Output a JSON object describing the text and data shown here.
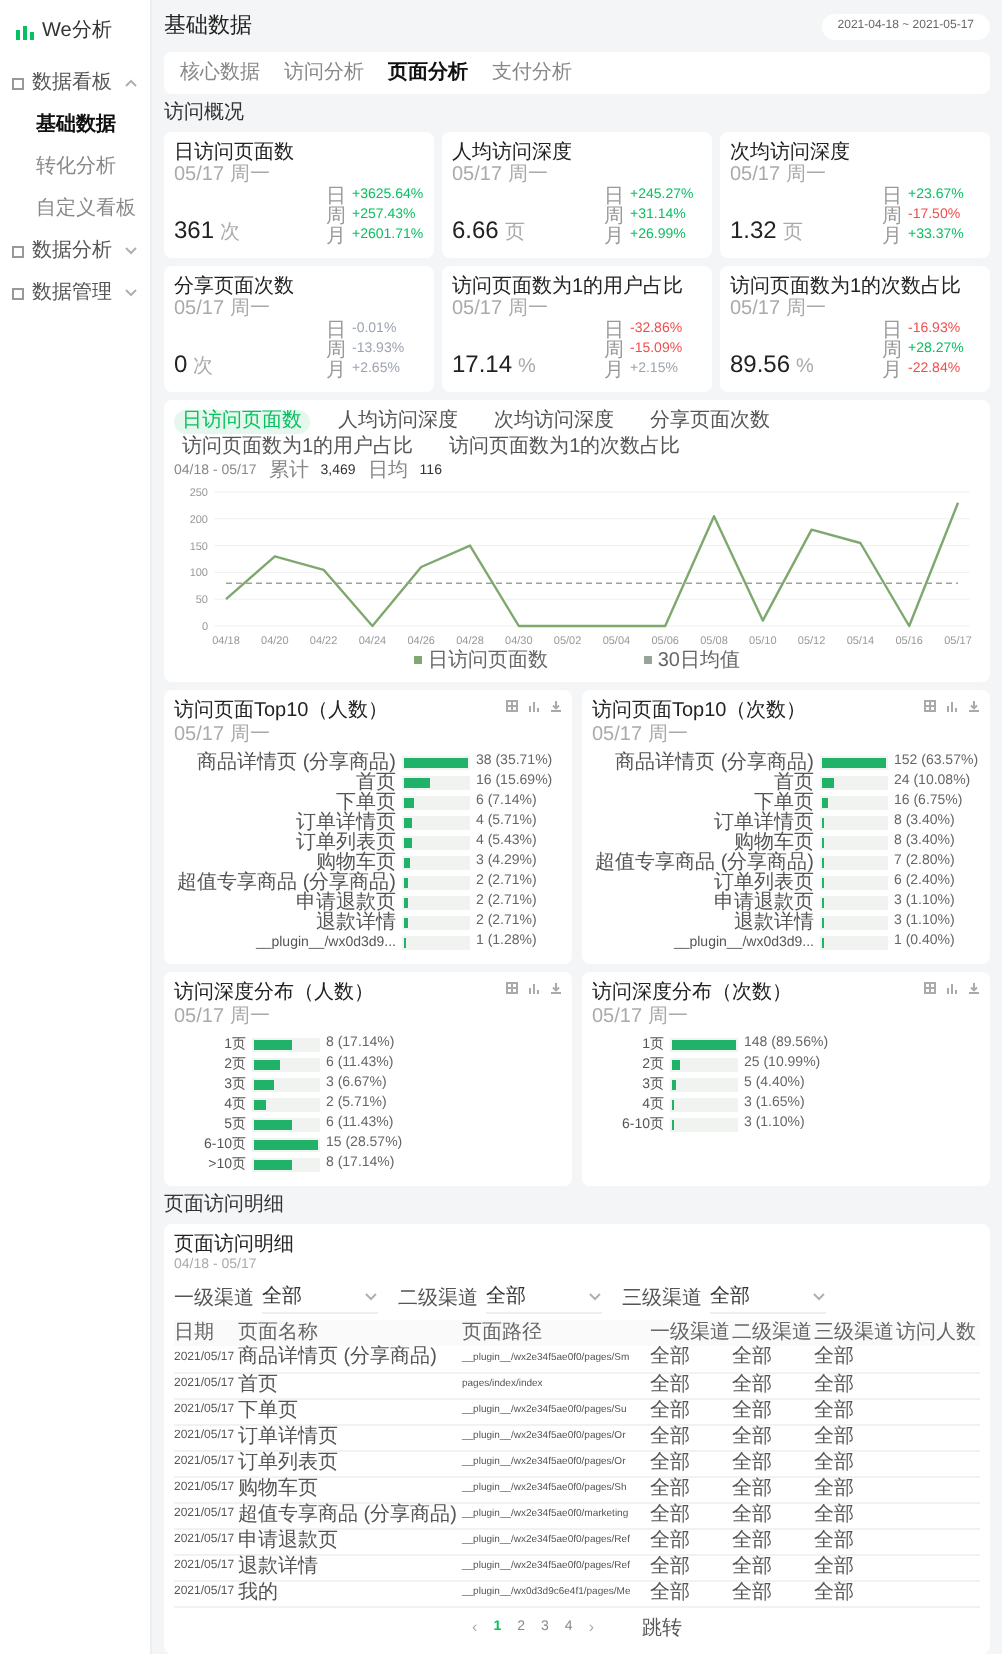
{
  "sidebar": {
    "logo": "We分析",
    "items": [
      {
        "label": "数据看板",
        "expanded": true,
        "children": [
          {
            "label": "基础数据",
            "selected": true
          },
          {
            "label": "转化分析",
            "selected": false
          },
          {
            "label": "自定义看板",
            "selected": false
          }
        ]
      },
      {
        "label": "数据分析",
        "expanded": false
      },
      {
        "label": "数据管理",
        "expanded": false
      }
    ]
  },
  "header": {
    "title": "基础数据",
    "date_range": "2021-04-18 ~ 2021-05-17"
  },
  "tabs": [
    {
      "label": "核心数据",
      "selected": false
    },
    {
      "label": "访问分析",
      "selected": false
    },
    {
      "label": "页面分析",
      "selected": true
    },
    {
      "label": "支付分析",
      "selected": false
    }
  ],
  "overview": {
    "title": "访问概况",
    "cards": [
      {
        "title": "日访问页面数",
        "date": "05/17 周一",
        "value": "361",
        "unit": "次",
        "changes": [
          {
            "label": "日",
            "value": "+3625.64%",
            "kind": "up"
          },
          {
            "label": "周",
            "value": "+257.43%",
            "kind": "up"
          },
          {
            "label": "月",
            "value": "+2601.71%",
            "kind": "up"
          }
        ]
      },
      {
        "title": "人均访问深度",
        "date": "05/17 周一",
        "value": "6.66",
        "unit": "页",
        "changes": [
          {
            "label": "日",
            "value": "+245.27%",
            "kind": "up"
          },
          {
            "label": "周",
            "value": "+31.14%",
            "kind": "up"
          },
          {
            "label": "月",
            "value": "+26.99%",
            "kind": "up"
          }
        ]
      },
      {
        "title": "次均访问深度",
        "date": "05/17 周一",
        "value": "1.32",
        "unit": "页",
        "changes": [
          {
            "label": "日",
            "value": "+23.67%",
            "kind": "up"
          },
          {
            "label": "周",
            "value": "-17.50%",
            "kind": "down"
          },
          {
            "label": "月",
            "value": "+33.37%",
            "kind": "up"
          }
        ]
      },
      {
        "title": "分享页面次数",
        "date": "05/17 周一",
        "value": "0",
        "unit": "次",
        "changes": [
          {
            "label": "日",
            "value": "-0.01%",
            "kind": "none"
          },
          {
            "label": "周",
            "value": "-13.93%",
            "kind": "none"
          },
          {
            "label": "月",
            "value": "+2.65%",
            "kind": "none"
          }
        ]
      },
      {
        "title": "访问页面数为1的用户占比",
        "date": "05/17 周一",
        "value": "17.14",
        "unit": "%",
        "changes": [
          {
            "label": "日",
            "value": "-32.86%",
            "kind": "down"
          },
          {
            "label": "周",
            "value": "-15.09%",
            "kind": "down"
          },
          {
            "label": "月",
            "value": "+2.15%",
            "kind": "none"
          }
        ]
      },
      {
        "title": "访问页面数为1的次数占比",
        "date": "05/17 周一",
        "value": "89.56",
        "unit": "%",
        "changes": [
          {
            "label": "日",
            "value": "-16.93%",
            "kind": "down"
          },
          {
            "label": "周",
            "value": "+28.27%",
            "kind": "up"
          },
          {
            "label": "月",
            "value": "-22.84%",
            "kind": "down"
          }
        ]
      }
    ]
  },
  "trend": {
    "tabs": [
      {
        "label": "日访问页面数",
        "selected": true
      },
      {
        "label": "人均访问深度",
        "selected": false
      },
      {
        "label": "次均访问深度",
        "selected": false
      },
      {
        "label": "分享页面次数",
        "selected": false
      },
      {
        "label": "访问页面数为1的用户占比",
        "selected": false
      },
      {
        "label": "访问页面数为1的次数占比",
        "selected": false
      }
    ],
    "range": "04/18 - 05/17",
    "total_label": "累计",
    "total": "3,469",
    "avg_label": "日均",
    "avg": "116",
    "chart_data": {
      "type": "line",
      "grid": true,
      "categories": [
        "04/18",
        "04/20",
        "04/22",
        "04/24",
        "04/26",
        "04/28",
        "04/30",
        "05/02",
        "05/04",
        "05/06",
        "05/08",
        "05/10",
        "05/12",
        "05/14",
        "05/16",
        "05/17"
      ],
      "yticks": [
        0,
        50,
        100,
        150,
        200,
        250
      ],
      "ylim": [
        0,
        250
      ],
      "series": [
        {
          "name": "日访问页面数",
          "color": "#7fa86e",
          "line_style": "solid",
          "values": [
            50,
            130,
            105,
            0,
            110,
            150,
            0,
            0,
            0,
            0,
            205,
            10,
            180,
            155,
            0,
            230
          ]
        },
        {
          "name": "30日均值",
          "color": "#9aa39a",
          "line_style": "dashed",
          "values": [
            80,
            80,
            80,
            80,
            80,
            80,
            80,
            80,
            80,
            80,
            80,
            80,
            80,
            80,
            80,
            80
          ]
        }
      ]
    }
  },
  "top_pages": [
    {
      "title": "访问页面Top10（人数）",
      "date": "05/17 周一",
      "rows": [
        {
          "label": "商品详情页 (分享商品)",
          "value": "38 (35.71%)",
          "level": 1
        },
        {
          "label": "首页",
          "value": "16 (15.69%)",
          "level": 0.42
        },
        {
          "label": "下单页",
          "value": "6 (7.14%)",
          "level": 0.16
        },
        {
          "label": "订单详情页",
          "value": "4 (5.71%)",
          "level": 0.11
        },
        {
          "label": "订单列表页",
          "value": "4 (5.43%)",
          "level": 0.11
        },
        {
          "label": "购物车页",
          "value": "3 (4.29%)",
          "level": 0.08
        },
        {
          "label": "超值专享商品 (分享商品)",
          "value": "2 (2.71%)",
          "level": 0.06
        },
        {
          "label": "申请退款页",
          "value": "2 (2.71%)",
          "level": 0.06
        },
        {
          "label": "退款详情",
          "value": "2 (2.71%)",
          "level": 0.06
        },
        {
          "label": "__plugin__/wx0d3d9...",
          "value": "1 (1.28%)",
          "level": 0.03
        }
      ]
    },
    {
      "title": "访问页面Top10（次数）",
      "date": "05/17 周一",
      "rows": [
        {
          "label": "商品详情页 (分享商品)",
          "value": "152 (63.57%)",
          "level": 1
        },
        {
          "label": "首页",
          "value": "24 (10.08%)",
          "level": 0.2
        },
        {
          "label": "下单页",
          "value": "16 (6.75%)",
          "level": 0.08
        },
        {
          "label": "订单详情页",
          "value": "8 (3.40%)",
          "level": 0.04
        },
        {
          "label": "购物车页",
          "value": "8 (3.40%)",
          "level": 0.04
        },
        {
          "label": "超值专享商品 (分享商品)",
          "value": "7 (2.80%)",
          "level": 0.04
        },
        {
          "label": "订单列表页",
          "value": "6 (2.40%)",
          "level": 0.03
        },
        {
          "label": "申请退款页",
          "value": "3 (1.10%)",
          "level": 0.01
        },
        {
          "label": "退款详情",
          "value": "3 (1.10%)",
          "level": 0.01
        },
        {
          "label": "__plugin__/wx0d3d9...",
          "value": "1 (0.40%)",
          "level": 0.005
        }
      ]
    }
  ],
  "depth": [
    {
      "title": "访问深度分布（人数）",
      "date": "05/17 周一",
      "rows": [
        {
          "label": "1页",
          "value": "8 (17.14%)",
          "level": 0.6
        },
        {
          "label": "2页",
          "value": "6 (11.43%)",
          "level": 0.4
        },
        {
          "label": "3页",
          "value": "3 (6.67%)",
          "level": 0.3
        },
        {
          "label": "4页",
          "value": "2 (5.71%)",
          "level": 0.2
        },
        {
          "label": "5页",
          "value": "6 (11.43%)",
          "level": 0.6
        },
        {
          "label": "6-10页",
          "value": "15 (28.57%)",
          "level": 1
        },
        {
          "label": ">10页",
          "value": "8 (17.14%)",
          "level": 0.6
        }
      ]
    },
    {
      "title": "访问深度分布（次数）",
      "date": "05/17 周一",
      "rows": [
        {
          "label": "1页",
          "value": "148 (89.56%)",
          "level": 1
        },
        {
          "label": "2页",
          "value": "25 (10.99%)",
          "level": 0.13
        },
        {
          "label": "3页",
          "value": "5 (4.40%)",
          "level": 0.05
        },
        {
          "label": "4页",
          "value": "3 (1.65%)",
          "level": 0.02
        },
        {
          "label": "6-10页",
          "value": "3 (1.10%)",
          "level": 0.02
        }
      ]
    }
  ],
  "detail": {
    "section": "页面访问明细",
    "title": "页面访问明细",
    "range": "04/18 - 05/17",
    "filters": [
      {
        "label": "一级渠道",
        "value": "全部"
      },
      {
        "label": "二级渠道",
        "value": "全部"
      },
      {
        "label": "三级渠道",
        "value": "全部"
      }
    ],
    "table": {
      "columns": [
        "日期",
        "页面名称",
        "页面路径",
        "一级渠道",
        "二级渠道",
        "三级渠道",
        "访问人数"
      ],
      "rows": [
        [
          "2021/05/17",
          "商品详情页 (分享商品)",
          "__plugin__/wx2e34f5ae0f0/pages/Sm",
          "全部",
          "全部",
          "全部"
        ],
        [
          "2021/05/17",
          "首页",
          "pages/index/index",
          "全部",
          "全部",
          "全部"
        ],
        [
          "2021/05/17",
          "下单页",
          "__plugin__/wx2e34f5ae0f0/pages/Su",
          "全部",
          "全部",
          "全部"
        ],
        [
          "2021/05/17",
          "订单详情页",
          "__plugin__/wx2e34f5ae0f0/pages/Or",
          "全部",
          "全部",
          "全部"
        ],
        [
          "2021/05/17",
          "订单列表页",
          "__plugin__/wx2e34f5ae0f0/pages/Or",
          "全部",
          "全部",
          "全部"
        ],
        [
          "2021/05/17",
          "购物车页",
          "__plugin__/wx2e34f5ae0f0/pages/Sh",
          "全部",
          "全部",
          "全部"
        ],
        [
          "2021/05/17",
          "超值专享商品 (分享商品)",
          "__plugin__/wx2e34f5ae0f0/marketing",
          "全部",
          "全部",
          "全部"
        ],
        [
          "2021/05/17",
          "申请退款页",
          "__plugin__/wx2e34f5ae0f0/pages/Ref",
          "全部",
          "全部",
          "全部"
        ],
        [
          "2021/05/17",
          "退款详情",
          "__plugin__/wx2e34f5ae0f0/pages/Ref",
          "全部",
          "全部",
          "全部"
        ],
        [
          "2021/05/17",
          "我的",
          "__plugin__/wx0d3d9c6e4f1/pages/Me",
          "全部",
          "全部",
          "全部"
        ]
      ]
    },
    "pagination": {
      "prev": "‹",
      "next": "›",
      "pages": [
        {
          "label": "1",
          "selected": true
        },
        {
          "label": "2",
          "selected": false
        },
        {
          "label": "3",
          "selected": false
        },
        {
          "label": "4",
          "selected": false
        }
      ],
      "jump": "跳转"
    }
  }
}
